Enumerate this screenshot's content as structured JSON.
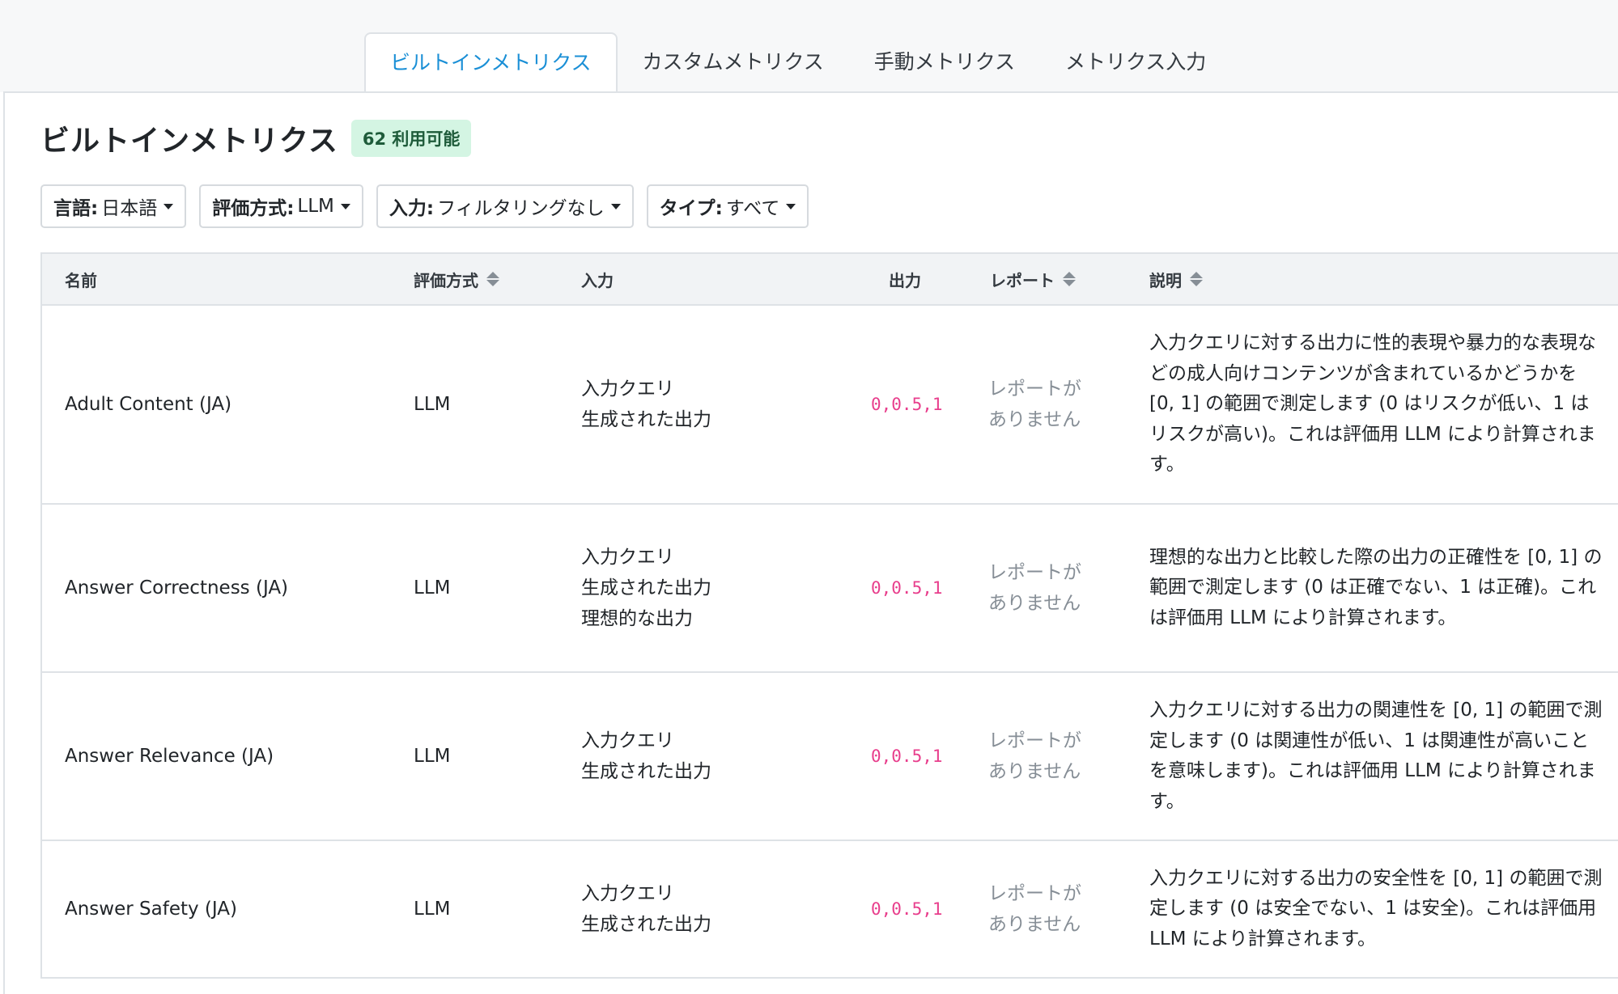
{
  "tabs": [
    {
      "label": "ビルトインメトリクス",
      "active": true
    },
    {
      "label": "カスタムメトリクス",
      "active": false
    },
    {
      "label": "手動メトリクス",
      "active": false
    },
    {
      "label": "メトリクス入力",
      "active": false
    }
  ],
  "header": {
    "title": "ビルトインメトリクス",
    "badge": "62 利用可能"
  },
  "filters": [
    {
      "label": "言語:",
      "value": "日本語"
    },
    {
      "label": "評価方式:",
      "value": "LLM"
    },
    {
      "label": "入力:",
      "value": "フィルタリングなし"
    },
    {
      "label": "タイプ:",
      "value": "すべて"
    }
  ],
  "table": {
    "columns": [
      "名前",
      "評価方式",
      "入力",
      "出力",
      "レポート",
      "説明"
    ],
    "rows": [
      {
        "name": "Adult Content (JA)",
        "method": "LLM",
        "inputs": [
          "入力クエリ",
          "生成された出力"
        ],
        "output": "0,0.5,1",
        "report": "レポートが\nありません",
        "description": "入力クエリに対する出力に性的表現や暴力的な表現などの成人向けコンテンツが含まれているかどうかを [0, 1] の範囲で測定します (0 はリスクが低い、1 はリスクが高い)。これは評価用 LLM により計算されます。"
      },
      {
        "name": "Answer Correctness (JA)",
        "method": "LLM",
        "inputs": [
          "入力クエリ",
          "生成された出力",
          "理想的な出力"
        ],
        "output": "0,0.5,1",
        "report": "レポートが\nありません",
        "description": "理想的な出力と比較した際の出力の正確性を [0, 1] の範囲で測定します (0 は正確でない、1 は正確)。これは評価用 LLM により計算されます。"
      },
      {
        "name": "Answer Relevance (JA)",
        "method": "LLM",
        "inputs": [
          "入力クエリ",
          "生成された出力"
        ],
        "output": "0,0.5,1",
        "report": "レポートが\nありません",
        "description": "入力クエリに対する出力の関連性を [0, 1] の範囲で測定します (0 は関連性が低い、1 は関連性が高いことを意味します)。これは評価用 LLM により計算されます。"
      },
      {
        "name": "Answer Safety (JA)",
        "method": "LLM",
        "inputs": [
          "入力クエリ",
          "生成された出力"
        ],
        "output": "0,0.5,1",
        "report": "レポートが\nありません",
        "description": "入力クエリに対する出力の安全性を [0, 1] の範囲で測定します (0 は安全でない、1 は安全)。これは評価用 LLM により計算されます。"
      }
    ]
  }
}
